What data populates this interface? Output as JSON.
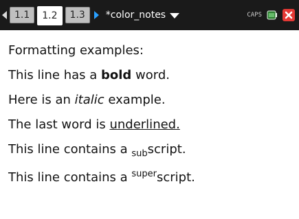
{
  "header": {
    "tabs": [
      "1.1",
      "1.2",
      "1.3"
    ],
    "active_tab_index": 1,
    "document_title": "*color_notes",
    "caps_text": "CAPS"
  },
  "content": {
    "heading": "Formatting examples:",
    "line_bold": {
      "pre": "This line has a ",
      "bold": "bold",
      "post": " word."
    },
    "line_italic": {
      "pre": "Here is an ",
      "italic": "italic",
      "post": " example."
    },
    "line_underline": {
      "pre": "The last word is ",
      "underline": "underlined."
    },
    "line_sub": {
      "pre": "This line contains a ",
      "sub": "sub",
      "post": "script."
    },
    "line_super": {
      "pre": "This line contains a ",
      "sup": "super",
      "post": "script."
    }
  },
  "colors": {
    "header_bg": "#1a1a1a",
    "tab_bg": "#bfbfbf",
    "active_tab_bg": "#ffffff",
    "nav_arrow_active": "#2aa0ff",
    "close_button": "#e53935"
  },
  "icons": {
    "nav_left": "chevron-left-icon",
    "nav_right": "chevron-right-icon",
    "dropdown": "chevron-down-icon",
    "battery": "battery-icon",
    "close": "close-icon"
  }
}
